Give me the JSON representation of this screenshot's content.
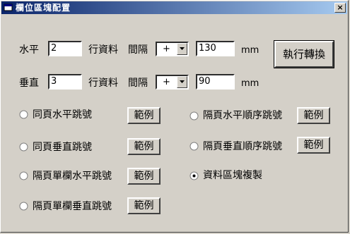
{
  "window": {
    "title": "欄位區塊配置",
    "close_glyph": "×"
  },
  "horizontal": {
    "label": "水平",
    "count": "2",
    "unit_label": "行資料",
    "gap_label": "間隔",
    "sign": "+",
    "gap_value": "130",
    "unit": "mm"
  },
  "vertical": {
    "label": "垂直",
    "count": "3",
    "unit_label": "行資料",
    "gap_label": "間隔",
    "sign": "+",
    "gap_value": "90",
    "unit": "mm"
  },
  "execute_button": "執行轉換",
  "example_label": "範例",
  "options": [
    {
      "label": "同頁水平跳號",
      "selected": false
    },
    {
      "label": "同頁垂直跳號",
      "selected": false
    },
    {
      "label": "隔頁單欄水平跳號",
      "selected": false
    },
    {
      "label": "隔頁單欄垂直跳號",
      "selected": false
    },
    {
      "label": "隔頁水平順序跳號",
      "selected": false
    },
    {
      "label": "隔頁垂直順序跳號",
      "selected": false
    },
    {
      "label": "資料區塊複製",
      "selected": true
    }
  ]
}
